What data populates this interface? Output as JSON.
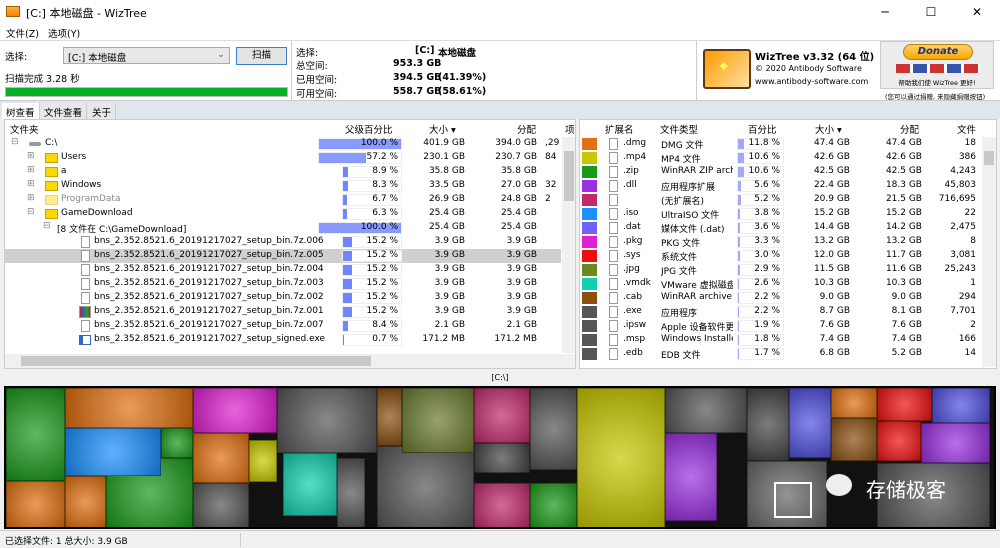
{
  "window": {
    "title": "[C:] 本地磁盘  - WizTree",
    "minimize": "─",
    "maximize": "☐",
    "close": "✕"
  },
  "menu": [
    "文件(Z)",
    "选项(Y)"
  ],
  "scan": {
    "select_label": "选择:",
    "drive_value": "[C:] 本地磁盘",
    "scan_button": "扫描",
    "status": "扫描完成 3.28 秒",
    "progress_percent": 100
  },
  "drive_info": {
    "select_label": "选择:",
    "drive": "[C:]",
    "drive_name": "本地磁盘",
    "total_label": "总空间:",
    "total": "953.3 GB",
    "used_label": "已用空间:",
    "used": "394.5 GB",
    "used_pct": "(41.39%)",
    "free_label": "可用空间:",
    "free": "558.7 GB",
    "free_pct": "(58.61%)"
  },
  "about": {
    "version": "WizTree v3.32 (64 位)",
    "copyright": "© 2020 Antibody Software",
    "website": "www.antibody-software.com",
    "donate": "Donate",
    "donate_text": "帮助我们使 WizTree 更好!",
    "donate_note": "(您可以通过捐赠, 来隐藏捐赠按钮)"
  },
  "tabs": [
    "树查看",
    "文件查看",
    "关于"
  ],
  "tree": {
    "columns": [
      "文件夹",
      "父级百分比",
      "大小 ▾",
      "分配",
      "项"
    ],
    "rows": [
      {
        "name": "C:\\",
        "pct": "100.0 %",
        "pv": 100,
        "size": "401.9 GB",
        "alloc": "394.0 GB",
        "items": ",29",
        "indent": 0,
        "icon": "drive",
        "exp": "⊟"
      },
      {
        "name": "Users",
        "pct": "57.2 %",
        "pv": 57.2,
        "size": "230.1 GB",
        "alloc": "230.7 GB",
        "items": "84",
        "indent": 1,
        "icon": "folder",
        "exp": "⊞"
      },
      {
        "name": "a",
        "pct": "8.9 %",
        "pv": 8.9,
        "size": "35.8 GB",
        "alloc": "35.8 GB",
        "items": "",
        "indent": 1,
        "icon": "folder",
        "exp": "⊞"
      },
      {
        "name": "Windows",
        "pct": "8.3 %",
        "pv": 8.3,
        "size": "33.5 GB",
        "alloc": "27.0 GB",
        "items": "32",
        "indent": 1,
        "icon": "folder",
        "exp": "⊞"
      },
      {
        "name": "ProgramData",
        "pct": "6.7 %",
        "pv": 6.7,
        "size": "26.9 GB",
        "alloc": "24.8 GB",
        "items": "2",
        "indent": 1,
        "icon": "folder-hidden",
        "exp": "⊞"
      },
      {
        "name": "GameDownload",
        "pct": "6.3 %",
        "pv": 6.3,
        "size": "25.4 GB",
        "alloc": "25.4 GB",
        "items": "",
        "indent": 1,
        "icon": "folder",
        "exp": "⊟"
      },
      {
        "name": "[8 文件在 C:\\GameDownload]",
        "pct": "100.0 %",
        "pv": 100,
        "size": "25.4 GB",
        "alloc": "25.4 GB",
        "items": "",
        "indent": 2,
        "icon": "none",
        "exp": "⊟"
      },
      {
        "name": "bns_2.352.8521.6_20191217027_setup_bin.7z.006",
        "pct": "15.2 %",
        "pv": 15.2,
        "size": "3.9 GB",
        "alloc": "3.9 GB",
        "items": "",
        "indent": 3,
        "icon": "file",
        "exp": ""
      },
      {
        "name": "bns_2.352.8521.6_20191217027_setup_bin.7z.005",
        "pct": "15.2 %",
        "pv": 15.2,
        "size": "3.9 GB",
        "alloc": "3.9 GB",
        "items": "",
        "indent": 3,
        "icon": "file",
        "exp": "",
        "selected": true
      },
      {
        "name": "bns_2.352.8521.6_20191217027_setup_bin.7z.004",
        "pct": "15.2 %",
        "pv": 15.2,
        "size": "3.9 GB",
        "alloc": "3.9 GB",
        "items": "",
        "indent": 3,
        "icon": "file",
        "exp": ""
      },
      {
        "name": "bns_2.352.8521.6_20191217027_setup_bin.7z.003",
        "pct": "15.2 %",
        "pv": 15.2,
        "size": "3.9 GB",
        "alloc": "3.9 GB",
        "items": "",
        "indent": 3,
        "icon": "file",
        "exp": ""
      },
      {
        "name": "bns_2.352.8521.6_20191217027_setup_bin.7z.002",
        "pct": "15.2 %",
        "pv": 15.2,
        "size": "3.9 GB",
        "alloc": "3.9 GB",
        "items": "",
        "indent": 3,
        "icon": "file",
        "exp": ""
      },
      {
        "name": "bns_2.352.8521.6_20191217027_setup_bin.7z.001",
        "pct": "15.2 %",
        "pv": 15.2,
        "size": "3.9 GB",
        "alloc": "3.9 GB",
        "items": "",
        "indent": 3,
        "icon": "winrar",
        "exp": ""
      },
      {
        "name": "bns_2.352.8521.6_20191217027_setup_bin.7z.007",
        "pct": "8.4 %",
        "pv": 8.4,
        "size": "2.1 GB",
        "alloc": "2.1 GB",
        "items": "",
        "indent": 3,
        "icon": "file",
        "exp": ""
      },
      {
        "name": "bns_2.352.8521.6_20191217027_setup_signed.exe",
        "pct": "0.7 %",
        "pv": 0.7,
        "size": "171.2 MB",
        "alloc": "171.2 MB",
        "items": "",
        "indent": 3,
        "icon": "exe",
        "exp": ""
      }
    ]
  },
  "extensions": {
    "columns": [
      "扩展名",
      "文件类型",
      "百分比",
      "大小 ▾",
      "分配",
      "文件"
    ],
    "rows": [
      {
        "color": "#e07010",
        "ext": ".dmg",
        "type": "DMG 文件",
        "pct": "11.8 %",
        "pv": 11.8,
        "size": "47.4 GB",
        "alloc": "47.4 GB",
        "files": "18"
      },
      {
        "color": "#c8c800",
        "ext": ".mp4",
        "type": "MP4 文件",
        "pct": "10.6 %",
        "pv": 10.6,
        "size": "42.6 GB",
        "alloc": "42.6 GB",
        "files": "386"
      },
      {
        "color": "#1a9a1a",
        "ext": ".zip",
        "type": "WinRAR ZIP archiv",
        "pct": "10.6 %",
        "pv": 10.6,
        "size": "42.5 GB",
        "alloc": "42.5 GB",
        "files": "4,243"
      },
      {
        "color": "#9a30e0",
        "ext": ".dll",
        "type": "应用程序扩展",
        "pct": "5.6 %",
        "pv": 5.6,
        "size": "22.4 GB",
        "alloc": "18.3 GB",
        "files": "45,803"
      },
      {
        "color": "#c02a6a",
        "ext": "",
        "type": "(无扩展名)",
        "pct": "5.2 %",
        "pv": 5.2,
        "size": "20.9 GB",
        "alloc": "21.5 GB",
        "files": "716,695"
      },
      {
        "color": "#1a90ff",
        "ext": ".iso",
        "type": "UltraISO 文件",
        "pct": "3.8 %",
        "pv": 3.8,
        "size": "15.2 GB",
        "alloc": "15.2 GB",
        "files": "22"
      },
      {
        "color": "#7060ff",
        "ext": ".dat",
        "type": "媒体文件 (.dat)",
        "pct": "3.6 %",
        "pv": 3.6,
        "size": "14.4 GB",
        "alloc": "14.2 GB",
        "files": "2,475"
      },
      {
        "color": "#e020d0",
        "ext": ".pkg",
        "type": "PKG 文件",
        "pct": "3.3 %",
        "pv": 3.3,
        "size": "13.2 GB",
        "alloc": "13.2 GB",
        "files": "8"
      },
      {
        "color": "#ee1010",
        "ext": ".sys",
        "type": "系统文件",
        "pct": "3.0 %",
        "pv": 3.0,
        "size": "12.0 GB",
        "alloc": "11.7 GB",
        "files": "3,081"
      },
      {
        "color": "#6a8a20",
        "ext": ".jpg",
        "type": "JPG 文件",
        "pct": "2.9 %",
        "pv": 2.9,
        "size": "11.5 GB",
        "alloc": "11.6 GB",
        "files": "25,243"
      },
      {
        "color": "#10d0b0",
        "ext": ".vmdk",
        "type": "VMware 虚拟磁盘",
        "pct": "2.6 %",
        "pv": 2.6,
        "size": "10.3 GB",
        "alloc": "10.3 GB",
        "files": "1"
      },
      {
        "color": "#8a5010",
        "ext": ".cab",
        "type": "WinRAR archive",
        "pct": "2.2 %",
        "pv": 2.2,
        "size": "9.0 GB",
        "alloc": "9.0 GB",
        "files": "294"
      },
      {
        "color": "#555555",
        "ext": ".exe",
        "type": "应用程序",
        "pct": "2.2 %",
        "pv": 2.2,
        "size": "8.7 GB",
        "alloc": "8.1 GB",
        "files": "7,701"
      },
      {
        "color": "#555555",
        "ext": ".ipsw",
        "type": "Apple 设备软件更",
        "pct": "1.9 %",
        "pv": 1.9,
        "size": "7.6 GB",
        "alloc": "7.6 GB",
        "files": "2"
      },
      {
        "color": "#555555",
        "ext": ".msp",
        "type": "Windows Installer",
        "pct": "1.8 %",
        "pv": 1.8,
        "size": "7.4 GB",
        "alloc": "7.4 GB",
        "files": "166"
      },
      {
        "color": "#555555",
        "ext": ".edb",
        "type": "EDB 文件",
        "pct": "1.7 %",
        "pv": 1.7,
        "size": "6.8 GB",
        "alloc": "5.2 GB",
        "files": "14"
      }
    ]
  },
  "treemap": {
    "label": "[C:\\]",
    "watermark": "存储极客"
  },
  "status": {
    "text": "已选择文件: 1  总大小: 3.9 GB"
  }
}
